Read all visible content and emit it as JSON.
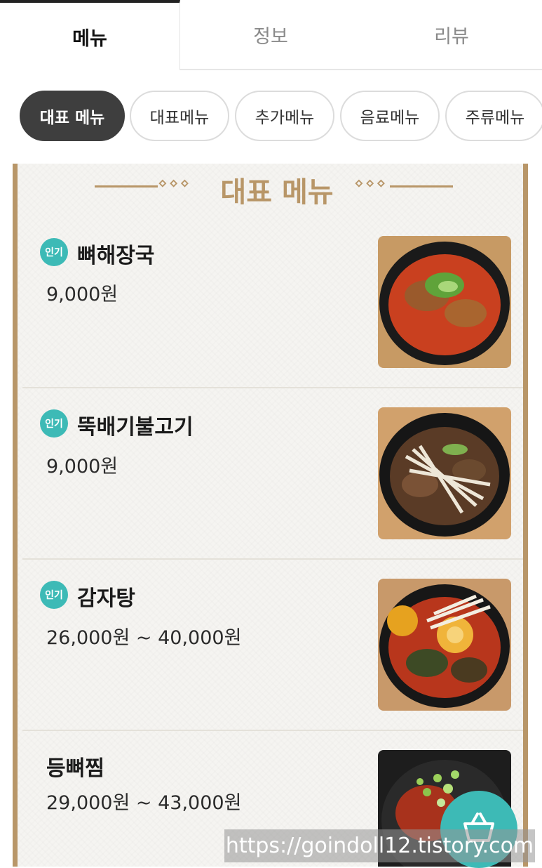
{
  "tabs": [
    {
      "label": "메뉴",
      "active": true
    },
    {
      "label": "정보",
      "active": false
    },
    {
      "label": "리뷰",
      "active": false
    }
  ],
  "chips": [
    {
      "label": "대표 메뉴",
      "active": true
    },
    {
      "label": "대표메뉴",
      "active": false
    },
    {
      "label": "추가메뉴",
      "active": false
    },
    {
      "label": "음료메뉴",
      "active": false
    },
    {
      "label": "주류메뉴",
      "active": false
    }
  ],
  "board": {
    "title": "대표 메뉴",
    "ornament_left": "⋄⋄⋄",
    "ornament_right": "⋄⋄⋄"
  },
  "items": [
    {
      "badge": "인기",
      "name": "뼈해장국",
      "price": "9,000원",
      "image": "bone-soup"
    },
    {
      "badge": "인기",
      "name": "뚝배기불고기",
      "price": "9,000원",
      "image": "bulgogi-hotpot"
    },
    {
      "badge": "인기",
      "name": "감자탕",
      "price": "26,000원 ~ 40,000원",
      "image": "gamjatang"
    },
    {
      "badge": "",
      "name": "등뼈찜",
      "price": "29,000원 ~ 43,000원",
      "image": "braised-backbone"
    }
  ],
  "fab": {
    "icon": "basket-icon"
  },
  "watermark": "https://goindoll12.tistory.com",
  "colors": {
    "accent": "#3dbab6",
    "gold": "#b89668",
    "dark_chip": "#3e3e3e"
  }
}
